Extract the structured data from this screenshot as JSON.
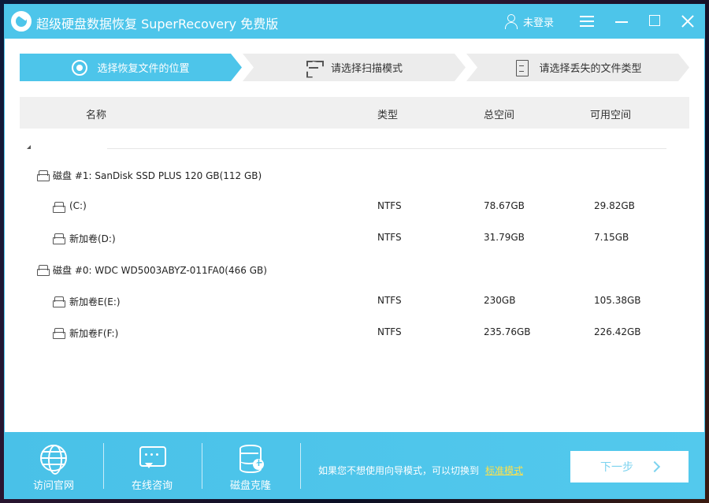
{
  "titlebar": {
    "app_title": "超级硬盘数据恢复 SuperRecovery 免费版",
    "login_label": "未登录"
  },
  "steps": [
    {
      "label": "选择恢复文件的位置",
      "icon": "location-icon",
      "active": true
    },
    {
      "label": "请选择扫描模式",
      "icon": "scan-icon",
      "active": false
    },
    {
      "label": "请选择丢失的文件类型",
      "icon": "file-icon",
      "active": false
    }
  ],
  "table": {
    "headers": {
      "name": "名称",
      "type": "类型",
      "total": "总空间",
      "free": "可用空间"
    },
    "disks": [
      {
        "label": "磁盘 #1: SanDisk SSD PLUS 120 GB(112 GB)",
        "partitions": [
          {
            "name": "(C:)",
            "type": "NTFS",
            "total": "78.67GB",
            "free": "29.82GB"
          },
          {
            "name": "新加卷(D:)",
            "type": "NTFS",
            "total": "31.79GB",
            "free": "7.15GB"
          }
        ]
      },
      {
        "label": "磁盘 #0: WDC WD5003ABYZ-011FA0(466 GB)",
        "partitions": [
          {
            "name": "新加卷E(E:)",
            "type": "NTFS",
            "total": "230GB",
            "free": "105.38GB"
          },
          {
            "name": "新加卷F(F:)",
            "type": "NTFS",
            "total": "235.76GB",
            "free": "226.42GB"
          }
        ]
      }
    ]
  },
  "footer": {
    "buttons": [
      {
        "label": "访问官网",
        "icon": "globe-icon"
      },
      {
        "label": "在线咨询",
        "icon": "chat-icon"
      },
      {
        "label": "磁盘克隆",
        "icon": "database-icon"
      }
    ],
    "switch_text": "如果您不想使用向导模式，可以切换到",
    "standard_mode_link": "标准模式",
    "next_label": "下一步"
  },
  "colors": {
    "accent": "#4dc5ea",
    "link": "#ffe14a"
  }
}
